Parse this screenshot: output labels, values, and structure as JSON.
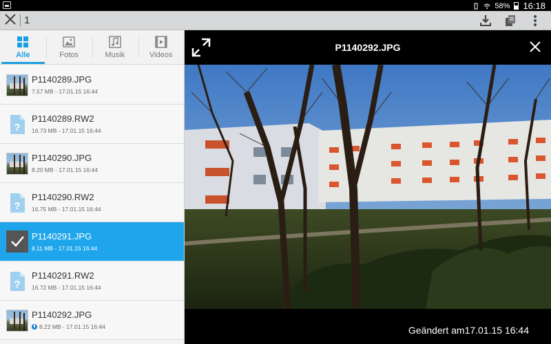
{
  "statusbar": {
    "battery": "58%",
    "time": "16:18"
  },
  "actionbar": {
    "selected_count": "1"
  },
  "tabs": [
    {
      "label": "Alle",
      "icon": "grid-icon",
      "active": true
    },
    {
      "label": "Fotos",
      "icon": "image-icon",
      "active": false
    },
    {
      "label": "Musik",
      "icon": "music-icon",
      "active": false
    },
    {
      "label": "Videos",
      "icon": "video-icon",
      "active": false
    }
  ],
  "files": [
    {
      "name": "P1140289.JPG",
      "meta": "7.57 MB - 17.01.15 16:44",
      "type": "photo"
    },
    {
      "name": "P1140289.RW2",
      "meta": "16.73 MB - 17.01.15 16:44",
      "type": "doc"
    },
    {
      "name": "P1140290.JPG",
      "meta": "8.20 MB - 17.01.15 16:44",
      "type": "photo"
    },
    {
      "name": "P1140290.RW2",
      "meta": "16.75 MB - 17.01.15 16:44",
      "type": "doc"
    },
    {
      "name": "P1140291.JPG",
      "meta": "8.11 MB - 17.01.15 16:44",
      "type": "selected"
    },
    {
      "name": "P1140291.RW2",
      "meta": "16.72 MB - 17.01.15 16:44",
      "type": "doc"
    },
    {
      "name": "P1140292.JPG",
      "meta": "8.22 MB - 17.01.15 16:44",
      "type": "photo-dl"
    }
  ],
  "viewer": {
    "title": "P1140292.JPG",
    "modified": "Geändert am17.01.15 16:44"
  },
  "colors": {
    "accent": "#1ea5eb",
    "actionbar": "#d7d8da"
  }
}
